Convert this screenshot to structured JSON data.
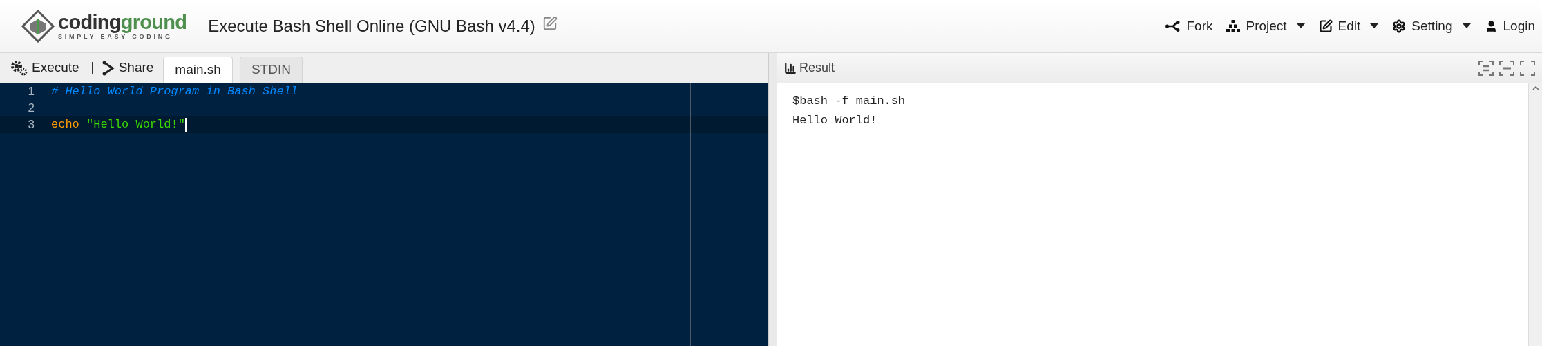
{
  "header": {
    "brand": [
      "coding",
      "ground"
    ],
    "tagline": "SIMPLY EASY CODING",
    "title": "Execute Bash Shell Online (GNU Bash v4.4)",
    "nav": [
      {
        "label": "Fork",
        "kind": "fork",
        "dropdown": false
      },
      {
        "label": "Project",
        "kind": "project",
        "dropdown": true
      },
      {
        "label": "Edit",
        "kind": "edit",
        "dropdown": true
      },
      {
        "label": "Setting",
        "kind": "setting",
        "dropdown": true
      },
      {
        "label": "Login",
        "kind": "login",
        "dropdown": false
      }
    ]
  },
  "toolbar": {
    "buttons": [
      {
        "label": "Execute",
        "kind": "execute"
      },
      {
        "label": "Share",
        "kind": "share"
      }
    ],
    "tabs": [
      {
        "label": "main.sh",
        "selected": true
      },
      {
        "label": "STDIN",
        "selected": false
      }
    ]
  },
  "editor": {
    "lines": [
      {
        "number": "1",
        "active": false,
        "tokens": [
          {
            "text": "# Hello World Program in Bash Shell",
            "kind": "comment"
          }
        ]
      },
      {
        "number": "2",
        "active": false
      },
      {
        "number": "3",
        "active": true,
        "cursor": true,
        "tokens": [
          {
            "text": "echo ",
            "kind": "keyword"
          },
          {
            "text": "\"Hello World!\"",
            "kind": "string"
          }
        ]
      }
    ]
  },
  "result": {
    "title": "Result",
    "output": [
      "$bash -f main.sh",
      "Hello World!"
    ]
  }
}
